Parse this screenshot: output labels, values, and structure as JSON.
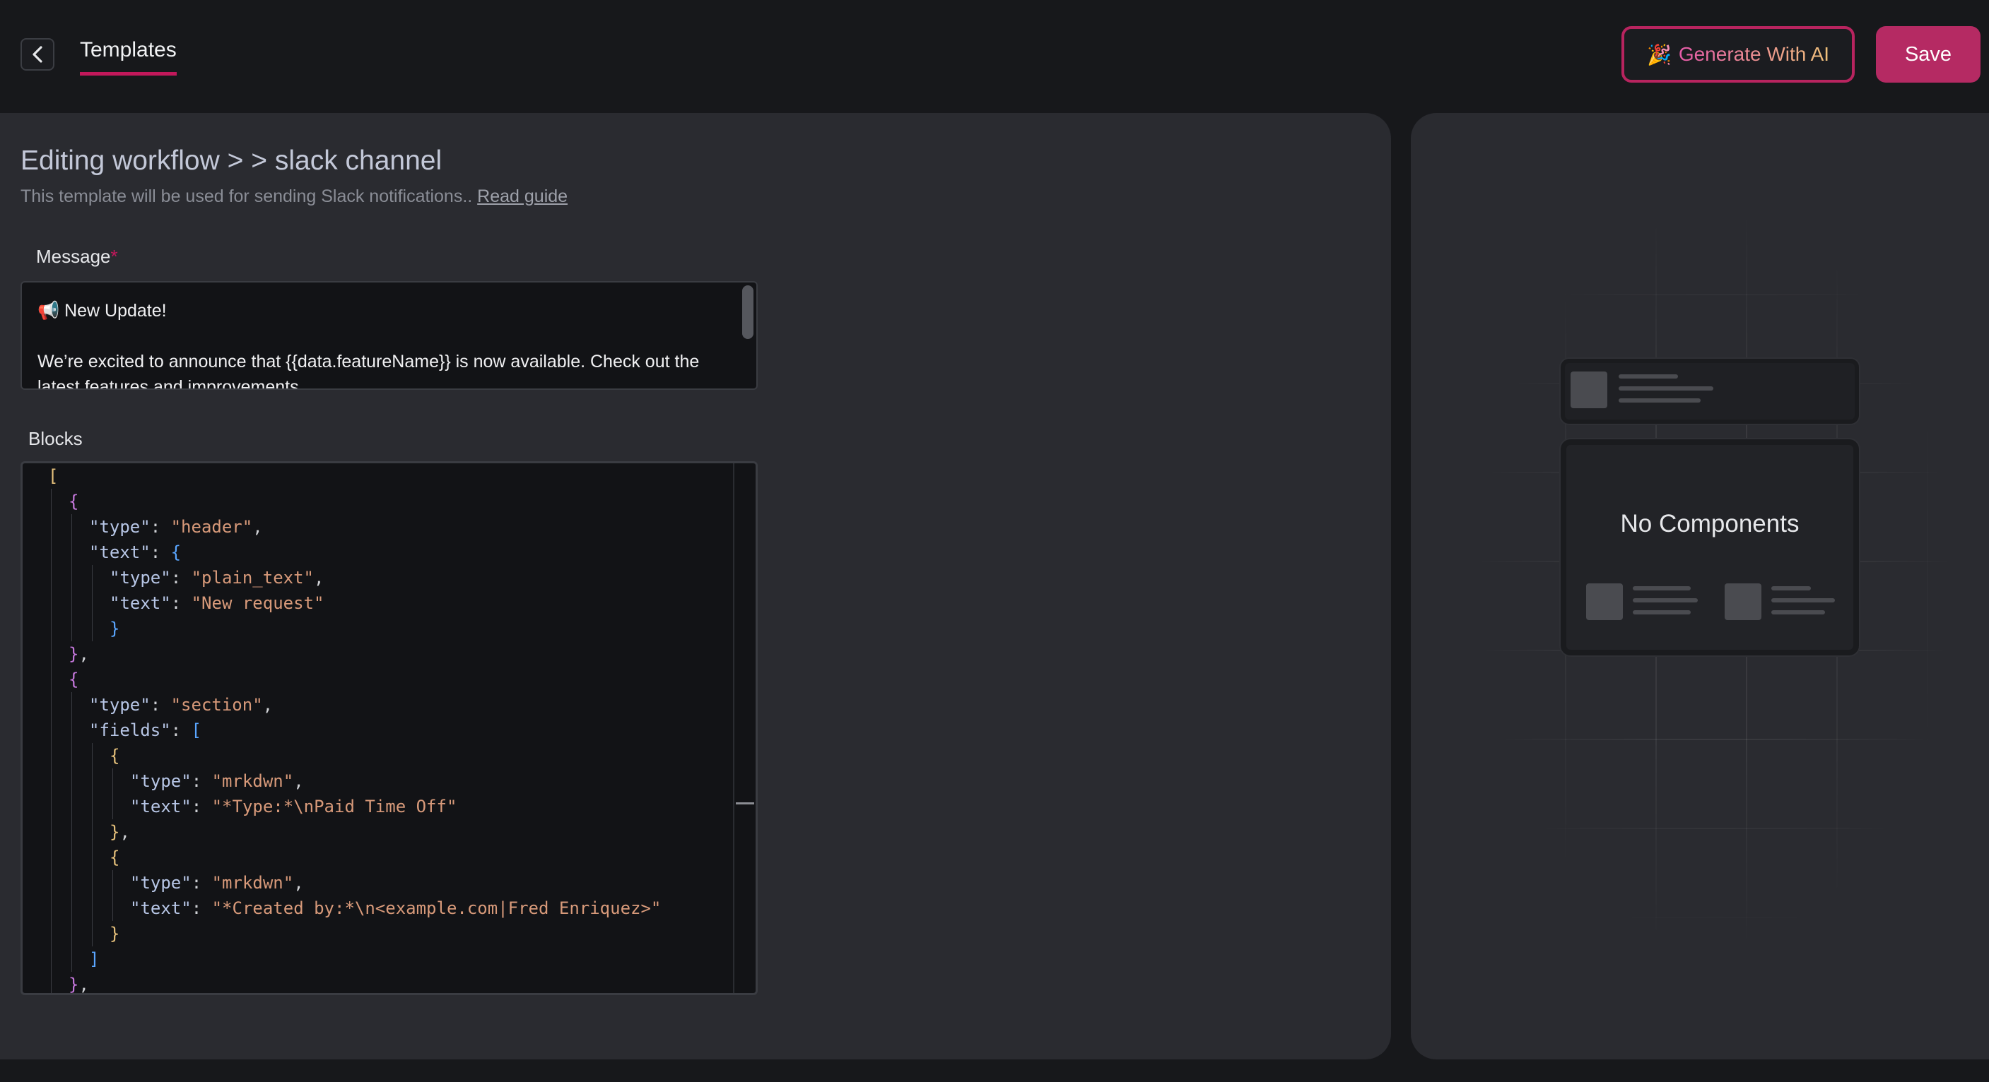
{
  "header": {
    "tab_label": "Templates",
    "generate_label": "Generate With AI",
    "generate_icon": "🎉",
    "save_label": "Save"
  },
  "editor": {
    "title": "Editing workflow > > slack channel",
    "subtitle": "This template will be used for sending Slack notifications..",
    "guide_link": "Read guide",
    "message_label": "Message",
    "required_mark": "*",
    "message_line1": "📢 New Update!",
    "message_line2": "We’re excited to announce that {{data.featureName}} is now available. Check out the latest features and improvements.",
    "blocks_label": "Blocks"
  },
  "blocks_code": [
    {
      "indent": 0,
      "tokens": [
        [
          "y",
          "["
        ]
      ]
    },
    {
      "indent": 1,
      "tokens": [
        [
          "m",
          "{"
        ]
      ]
    },
    {
      "indent": 2,
      "tokens": [
        [
          "k",
          "\"type\""
        ],
        [
          "p",
          ": "
        ],
        [
          "s",
          "\"header\""
        ],
        [
          "p",
          ","
        ]
      ]
    },
    {
      "indent": 2,
      "tokens": [
        [
          "k",
          "\"text\""
        ],
        [
          "p",
          ": "
        ],
        [
          "b",
          "{"
        ]
      ]
    },
    {
      "indent": 3,
      "tokens": [
        [
          "k",
          "\"type\""
        ],
        [
          "p",
          ": "
        ],
        [
          "s",
          "\"plain_text\""
        ],
        [
          "p",
          ","
        ]
      ]
    },
    {
      "indent": 3,
      "tokens": [
        [
          "k",
          "\"text\""
        ],
        [
          "p",
          ": "
        ],
        [
          "s",
          "\"New request\""
        ]
      ]
    },
    {
      "indent": 3,
      "tokens": [
        [
          "b",
          "}"
        ]
      ]
    },
    {
      "indent": 1,
      "tokens": [
        [
          "m",
          "}"
        ],
        [
          "p",
          ","
        ]
      ]
    },
    {
      "indent": 1,
      "tokens": [
        [
          "m",
          "{"
        ]
      ]
    },
    {
      "indent": 2,
      "tokens": [
        [
          "k",
          "\"type\""
        ],
        [
          "p",
          ": "
        ],
        [
          "s",
          "\"section\""
        ],
        [
          "p",
          ","
        ]
      ]
    },
    {
      "indent": 2,
      "tokens": [
        [
          "k",
          "\"fields\""
        ],
        [
          "p",
          ": "
        ],
        [
          "b",
          "["
        ]
      ]
    },
    {
      "indent": 3,
      "tokens": [
        [
          "y",
          "{"
        ]
      ]
    },
    {
      "indent": 4,
      "tokens": [
        [
          "k",
          "\"type\""
        ],
        [
          "p",
          ": "
        ],
        [
          "s",
          "\"mrkdwn\""
        ],
        [
          "p",
          ","
        ]
      ]
    },
    {
      "indent": 4,
      "tokens": [
        [
          "k",
          "\"text\""
        ],
        [
          "p",
          ": "
        ],
        [
          "s",
          "\"*Type:*\\nPaid Time Off\""
        ]
      ]
    },
    {
      "indent": 3,
      "tokens": [
        [
          "y",
          "}"
        ],
        [
          "p",
          ","
        ]
      ]
    },
    {
      "indent": 3,
      "tokens": [
        [
          "y",
          "{"
        ]
      ]
    },
    {
      "indent": 4,
      "tokens": [
        [
          "k",
          "\"type\""
        ],
        [
          "p",
          ": "
        ],
        [
          "s",
          "\"mrkdwn\""
        ],
        [
          "p",
          ","
        ]
      ]
    },
    {
      "indent": 4,
      "tokens": [
        [
          "k",
          "\"text\""
        ],
        [
          "p",
          ": "
        ],
        [
          "s",
          "\"*Created by:*\\n<example.com|Fred Enriquez>\""
        ]
      ]
    },
    {
      "indent": 3,
      "tokens": [
        [
          "y",
          "}"
        ]
      ]
    },
    {
      "indent": 2,
      "tokens": [
        [
          "b",
          "]"
        ]
      ]
    },
    {
      "indent": 1,
      "tokens": [
        [
          "m",
          "}"
        ],
        [
          "p",
          ","
        ]
      ]
    }
  ],
  "preview": {
    "empty_text": "No Components"
  }
}
